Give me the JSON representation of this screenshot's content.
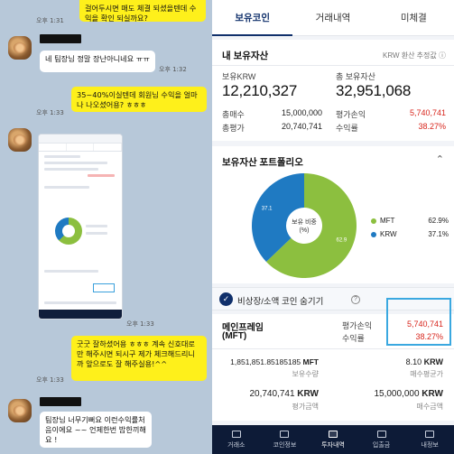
{
  "chat": {
    "messages": [
      {
        "kind": "me",
        "text": "걸어두시면 매도 체결 되셨을텐데 수익을 확인 되실까요?",
        "time": "오후 1:31"
      },
      {
        "kind": "them",
        "text": "네 팀장님 정말 장난아니네요 ㅠㅠ",
        "time": "오후 1:32"
      },
      {
        "kind": "me",
        "text": "35~40%이실텐데 회원님 수익을 얼마나 나오셨어용? ㅎㅎㅎ",
        "time": "오후 1:33"
      },
      {
        "kind": "them_image",
        "time": "오후 1:33"
      },
      {
        "kind": "me",
        "text": "굿굿 잘하셨어용 ㅎㅎㅎ 계속 신호대로만 해주시면 되시구 제가 체크해드리니까 앞으로도 잘 해주실용!^^",
        "time": "오후 1:33"
      },
      {
        "kind": "them",
        "text": "팀장님 너무기뻐요 이런수익률처음이에요 ~~ 언제한번 밥한끼해요 !",
        "time": ""
      }
    ]
  },
  "app": {
    "tabs": [
      {
        "label": "보유코인",
        "active": true
      },
      {
        "label": "거래내역",
        "active": false
      },
      {
        "label": "미체결",
        "active": false
      }
    ],
    "assets": {
      "title": "내 보유자산",
      "krw_link": "KRW 환산 추정값 ⓘ",
      "krw_label": "보유KRW",
      "krw_value": "12,210,327",
      "total_label": "총 보유자산",
      "total_value": "32,951,068",
      "buy_label": "총매수",
      "buy_value": "15,000,000",
      "eval_label": "총평가",
      "eval_value": "20,740,741",
      "pl_label": "평가손익",
      "pl_value": "5,740,741",
      "rate_label": "수익률",
      "rate_value": "38.27%"
    },
    "portfolio": {
      "title": "보유자산 포트폴리오",
      "chevron": "⌃",
      "center_label": "보유 비중\n(%)",
      "legend": [
        {
          "name": "MFT",
          "pct": "62.9%",
          "color": "#8cbf3f"
        },
        {
          "name": "KRW",
          "pct": "37.1%",
          "color": "#1f7ac2"
        }
      ],
      "slice_labels": [
        "62.9",
        "37.1"
      ]
    },
    "chart_data": {
      "type": "pie",
      "categories": [
        "MFT",
        "KRW"
      ],
      "values": [
        62.9,
        37.1
      ],
      "title": "보유자산 포트폴리오",
      "colors": [
        "#8cbf3f",
        "#1f7ac2"
      ],
      "legend_position": "right"
    },
    "hide_row": {
      "label": "비상장/소액 코인 숨기기",
      "help": "?"
    },
    "coin": {
      "name": "메인프레임",
      "symbol": "(MFT)",
      "pl_label": "평가손익",
      "pl_value": "5,740,741",
      "rate_label": "수익률",
      "rate_value": "38.27%",
      "qty_value": "1,851,851.85185185",
      "qty_unit": "MFT",
      "qty_label": "보유수량",
      "avg_value": "8.10",
      "avg_unit": "KRW",
      "avg_label": "매수평균가",
      "eval_value": "20,740,741",
      "eval_unit": "KRW",
      "eval_label": "평가금액",
      "buy_value": "15,000,000",
      "buy_unit": "KRW",
      "buy_label": "매수금액"
    },
    "nav": [
      {
        "label": "거래소",
        "active": false
      },
      {
        "label": "코인정보",
        "active": false
      },
      {
        "label": "투자내역",
        "active": true
      },
      {
        "label": "입출금",
        "active": false
      },
      {
        "label": "내정보",
        "active": false
      }
    ]
  }
}
